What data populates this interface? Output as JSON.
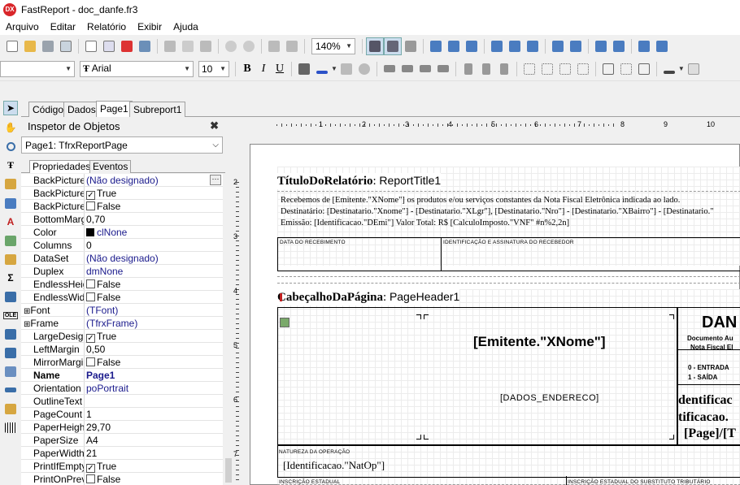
{
  "window": {
    "logo": "DX",
    "title": "FastReport - doc_danfe.fr3"
  },
  "menu": [
    "Arquivo",
    "Editar",
    "Relatório",
    "Exibir",
    "Ajuda"
  ],
  "toolbar": {
    "zoom": "140%",
    "font_name": "Arial",
    "font_size": "10",
    "bold": "B",
    "italic": "I",
    "underline": "U"
  },
  "tabs": [
    "Código",
    "Dados",
    "Page1",
    "Subreport1"
  ],
  "inspector": {
    "title": "Inspetor de Objetos",
    "object": "Page1: TfrxReportPage",
    "tabs": [
      "Propriedades",
      "Eventos"
    ],
    "properties": [
      {
        "name": "BackPicture",
        "value": "(Não designado)"
      },
      {
        "name": "BackPicturePri",
        "value": "True",
        "checkbox": true
      },
      {
        "name": "BackPictureVi",
        "value": "False",
        "checkbox": false
      },
      {
        "name": "BottomMargin",
        "value": "0,70"
      },
      {
        "name": "Color",
        "value": "clNone"
      },
      {
        "name": "Columns",
        "value": "0"
      },
      {
        "name": "DataSet",
        "value": "(Não designado)"
      },
      {
        "name": "Duplex",
        "value": "dmNone"
      },
      {
        "name": "EndlessHeigh",
        "value": "False",
        "checkbox": false
      },
      {
        "name": "EndlessWidth",
        "value": "False",
        "checkbox": false
      },
      {
        "name": "Font",
        "value": "(TFont)",
        "expandable": true
      },
      {
        "name": "Frame",
        "value": "(TfrxFrame)",
        "expandable": true
      },
      {
        "name": "LargeDesignH",
        "value": "True",
        "checkbox": true
      },
      {
        "name": "LeftMargin",
        "value": "0,50"
      },
      {
        "name": "MirrorMargins",
        "value": "False",
        "checkbox": false
      },
      {
        "name": "Name",
        "value": "Page1",
        "bold": true
      },
      {
        "name": "Orientation",
        "value": "poPortrait"
      },
      {
        "name": "OutlineText",
        "value": ""
      },
      {
        "name": "PageCount",
        "value": "1"
      },
      {
        "name": "PaperHeight",
        "value": "29,70"
      },
      {
        "name": "PaperSize",
        "value": "A4"
      },
      {
        "name": "PaperWidth",
        "value": "21"
      },
      {
        "name": "PrintIfEmpty",
        "value": "True",
        "checkbox": true
      },
      {
        "name": "PrintOnPrevio",
        "value": "False",
        "checkbox": false
      }
    ]
  },
  "design": {
    "ruler_numbers": [
      "1",
      "2",
      "3",
      "4",
      "5",
      "6",
      "7",
      "8",
      "9",
      "10"
    ],
    "vruler_numbers": [
      "2",
      "3",
      "4",
      "5",
      "6",
      "7"
    ],
    "report_title": {
      "caption": "TítuloDoRelatório",
      "name": "ReportTitle1"
    },
    "rt_lines": [
      "Recebemos de [Emitente.\"XNome\"] os produtos e/ou serviços constantes da Nota Fiscal Eletrônica indicada ao lado.",
      "Destinatário: [Destinatario.\"Xnome\"] - [Destinatario.\"XLgr\"], [Destinatario.\"Nro\"] - [Destinatario.\"XBairro\"] - [Destinatario.\"",
      "Emissão: [Identificacao.\"DEmi\"]  Valor Total: R$ [CalculoImposto.\"VNF\" #n%2,2n]"
    ],
    "data_recebimento": "DATA DO RECEBIMENTO",
    "identificacao_assinatura": "IDENTIFICAÇÃO E ASSINATURA DO RECEBEDOR",
    "page_header": {
      "caption": "CabeçalhoDaPágina",
      "name": "PageHeader1"
    },
    "emitente": "[Emitente.\"XNome\"]",
    "endereco": "[DADOS_ENDERECO]",
    "danfe": "DAN",
    "doc_aux": "Documento Au",
    "nf_el": "Nota Fiscal El",
    "entrada": "0 - ENTRADA",
    "saida": "1 - SAÍDA",
    "ident1": "dentificac",
    "ident2": "tificacao.",
    "page_field": "[Page]/[T",
    "natureza_label": "NATUREZA DA OPERAÇÃO",
    "natop": "[Identificacao.\"NatOp\"]",
    "insc_estadual": "INSCRIÇÃO ESTADUAL",
    "insc_subst": "INSCRIÇÃO ESTADUAL DO SUBSTITUTO TRIBUTÁRIO"
  }
}
